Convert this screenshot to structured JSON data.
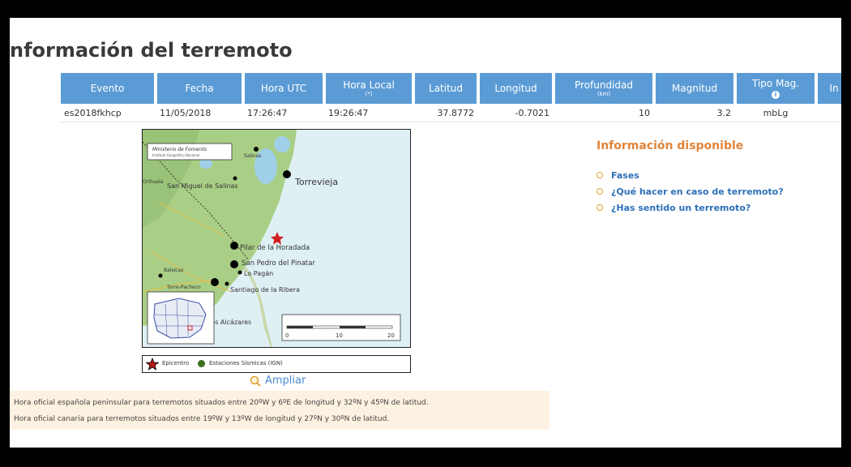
{
  "page": {
    "title": "nformación del terremoto"
  },
  "table": {
    "headers": [
      {
        "label": "Evento",
        "sub": ""
      },
      {
        "label": "Fecha",
        "sub": ""
      },
      {
        "label": "Hora UTC",
        "sub": ""
      },
      {
        "label": "Hora Local",
        "sub": "(*)"
      },
      {
        "label": "Latitud",
        "sub": ""
      },
      {
        "label": "Longitud",
        "sub": ""
      },
      {
        "label": "Profundidad",
        "sub": "(km)"
      },
      {
        "label": "Magnitud",
        "sub": ""
      },
      {
        "label": "Tipo Mag.",
        "sub": ""
      },
      {
        "label": "In",
        "sub": ""
      }
    ],
    "row": [
      "es2018fkhcp",
      "11/05/2018",
      "17:26:47",
      "19:26:47",
      "37.8772",
      "-0.7021",
      "10",
      "3.2",
      "mbLg"
    ]
  },
  "map": {
    "attribution_1": "Ministerio de Fomento",
    "attribution_2": "Instituto Geográfico Nacional",
    "places": {
      "torrevieja": "Torrevieja",
      "san_miguel": "San Miguel de Salinas",
      "pilar": "Pilar de la Horadada",
      "san_pedro": "San Pedro del Pinatar",
      "lo_pagan": "Lo Pagán",
      "santiago": "Santiago de la Ribera",
      "alcazares": "Los Alcázares",
      "orihuela": "Orihuela",
      "guardamar": "Guardamar",
      "salinas": "Salinas",
      "balsicas": "Balsicas",
      "torre_pacheco": "Torre-Pacheco"
    },
    "scale": [
      "0",
      "10",
      "20"
    ],
    "legend": {
      "epicenter": "Epicentro",
      "stations": "Estaciones Sísmicas (IGN)"
    }
  },
  "zoom_label": "Ampliar",
  "info": {
    "title": "Información disponible",
    "links": [
      "Fases",
      "¿Qué hacer en caso de terremoto?",
      "¿Has sentido un terremoto?"
    ]
  },
  "notes": [
    "Hora oficial española peninsular para terremotos situados entre 20ºW y 6ºE de longitud y 32ºN y 45ºN de latitud.",
    "Hora oficial canaria para terremotos situados entre 19ºW y 13ºW de longitud y 27ºN y 30ºN de latitud."
  ],
  "colors": {
    "header_bg": "#5b9bd5",
    "accent_orange": "#e0843a",
    "link_blue": "#2e6fb8",
    "sea": "#dff0f5",
    "land": "#a9cf86",
    "epicenter": "#d42020"
  },
  "icons": [
    "zoom-magnifier-icon",
    "info-icon",
    "star-icon",
    "station-dot-icon",
    "bullet-icon"
  ]
}
